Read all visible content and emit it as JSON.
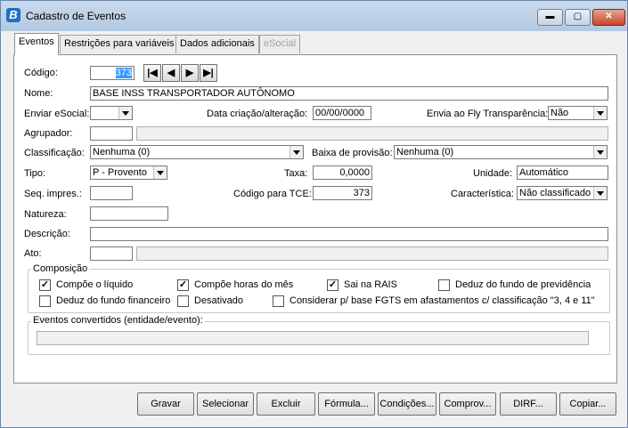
{
  "window": {
    "title": "Cadastro de Eventos",
    "app_icon_letter": "B",
    "minimize": "▬",
    "maximize": "▢",
    "close": "✕"
  },
  "tabs": [
    {
      "label": "Eventos",
      "state": "active"
    },
    {
      "label": "Restrições para variáveis",
      "state": "normal"
    },
    {
      "label": "Dados adicionais",
      "state": "normal"
    },
    {
      "label": "eSocial",
      "state": "disabled"
    }
  ],
  "form": {
    "codigo": {
      "label": "Código:",
      "value": "373"
    },
    "nav": {
      "first": "|◀",
      "prev": "◀",
      "next": "▶",
      "last": "▶|"
    },
    "nome": {
      "label": "Nome:",
      "value": "BASE INSS TRANSPORTADOR AUTÔNOMO"
    },
    "enviar_esocial": {
      "label": "Enviar eSocial:",
      "value": ""
    },
    "data_criacao": {
      "label": "Data criação/alteração:",
      "value": "00/00/0000"
    },
    "envia_fly": {
      "label": "Envia ao Fly Transparência:",
      "value": "Não"
    },
    "agrupador": {
      "label": "Agrupador:",
      "value": ""
    },
    "classificacao": {
      "label": "Classificação:",
      "value": "Nenhuma (0)"
    },
    "baixa_provisao": {
      "label": "Baixa de provisão:",
      "value": "Nenhuma (0)"
    },
    "tipo": {
      "label": "Tipo:",
      "value": "P - Provento"
    },
    "taxa": {
      "label": "Taxa:",
      "value": "0,0000"
    },
    "unidade": {
      "label": "Unidade:",
      "value": "Automático"
    },
    "seq_impres": {
      "label": "Seq. impres.:",
      "value": ""
    },
    "codigo_tce": {
      "label": "Código para TCE:",
      "value": "373"
    },
    "caracteristica": {
      "label": "Característica:",
      "value": "Não classificado"
    },
    "natureza": {
      "label": "Natureza:",
      "value": ""
    },
    "descricao": {
      "label": "Descrição:",
      "value": ""
    },
    "ato": {
      "label": "Ato:",
      "value": ""
    }
  },
  "composicao": {
    "title": "Composição",
    "items": [
      {
        "label": "Compõe o líquido",
        "checked": true
      },
      {
        "label": "Compõe horas do mês",
        "checked": true
      },
      {
        "label": "Sai na RAIS",
        "checked": true
      },
      {
        "label": "Deduz do fundo de previdência",
        "checked": false
      },
      {
        "label": "Deduz do fundo financeiro",
        "checked": false
      },
      {
        "label": "Desativado",
        "checked": false
      },
      {
        "label": "Considerar p/ base FGTS em afastamentos c/ classificação \"3, 4 e 11\"",
        "checked": false
      }
    ]
  },
  "eventos_convertidos": {
    "title": "Eventos convertidos (entidade/evento):",
    "value": ""
  },
  "buttons": [
    "Gravar",
    "Selecionar",
    "Excluir",
    "Fórmula...",
    "Condições...",
    "Comprov...",
    "DIRF...",
    "Copiar..."
  ],
  "colors": {
    "accent": "#1f6fc5",
    "selection": "#3399ff",
    "titlebar": "#b9cde3"
  }
}
